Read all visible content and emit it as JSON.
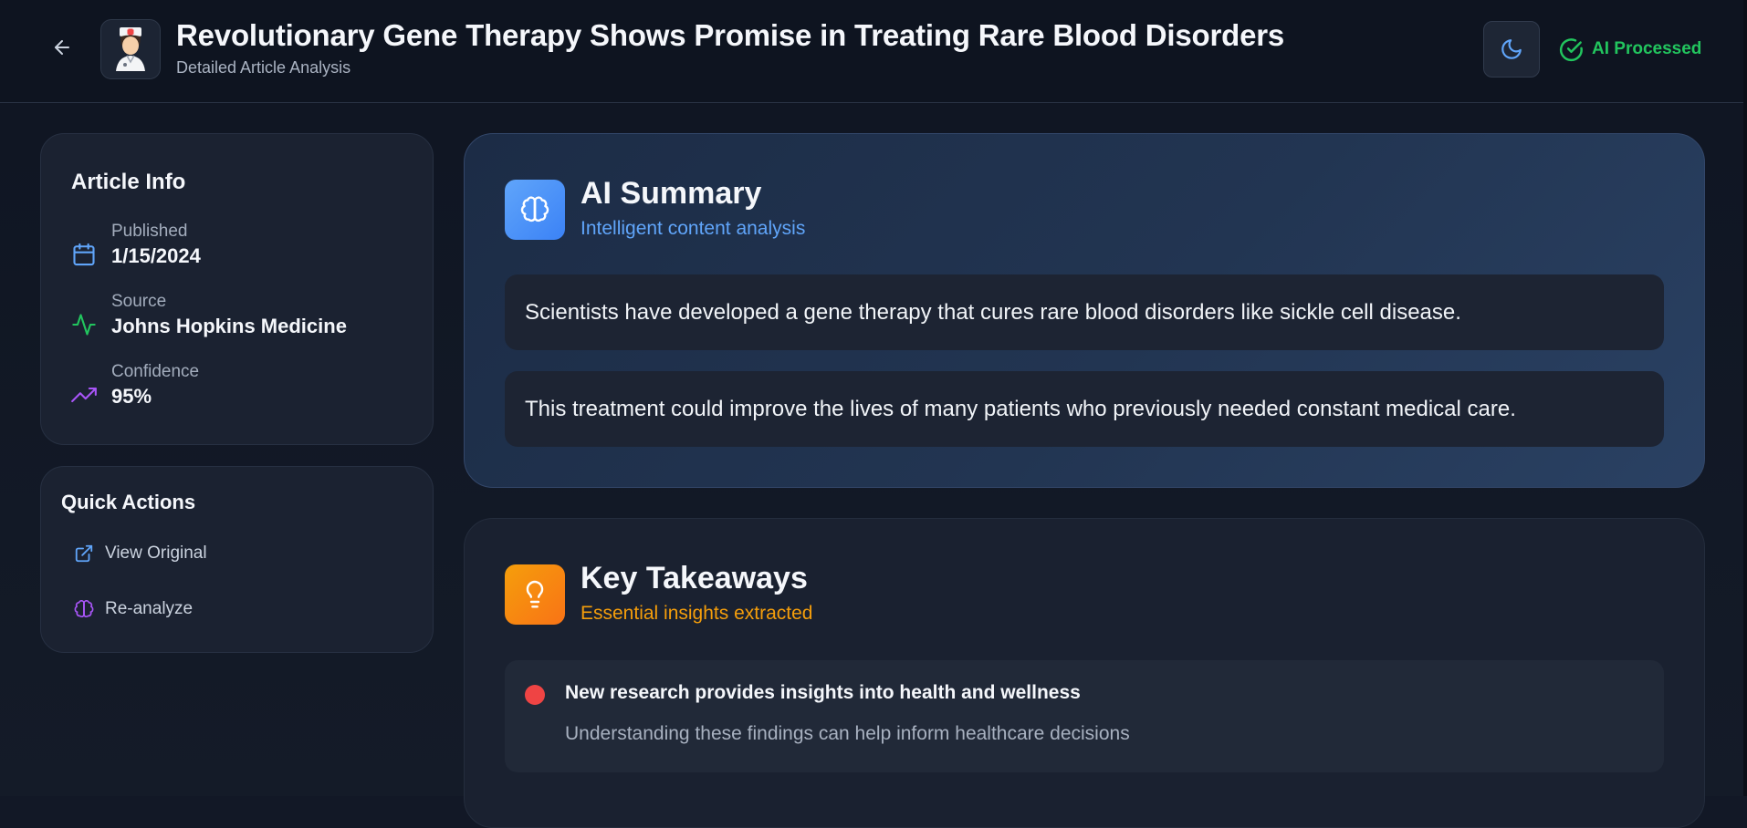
{
  "header": {
    "title": "Revolutionary Gene Therapy Shows Promise in Treating Rare Blood Disorders",
    "subtitle": "Detailed Article Analysis",
    "status": "AI Processed",
    "icons": {
      "back": "arrow-left-icon",
      "avatar": "doctor-avatar",
      "theme": "moon-icon",
      "status": "check-circle-icon"
    }
  },
  "article_info": {
    "title": "Article Info",
    "rows": [
      {
        "label": "Published",
        "value": "1/15/2024",
        "icon": "calendar-icon"
      },
      {
        "label": "Source",
        "value": "Johns Hopkins Medicine",
        "icon": "activity-icon"
      },
      {
        "label": "Confidence",
        "value": "95%",
        "icon": "trending-up-icon"
      }
    ]
  },
  "quick_actions": {
    "title": "Quick Actions",
    "items": [
      {
        "label": "View Original",
        "icon": "external-link-icon"
      },
      {
        "label": "Re-analyze",
        "icon": "brain-icon"
      }
    ]
  },
  "ai_summary": {
    "title": "AI Summary",
    "subtitle": "Intelligent content analysis",
    "icon": "brain-icon",
    "items": [
      "Scientists have developed a gene therapy that cures rare blood disorders like sickle cell disease.",
      "This treatment could improve the lives of many patients who previously needed constant medical care."
    ]
  },
  "key_takeaways": {
    "title": "Key Takeaways",
    "subtitle": "Essential insights extracted",
    "icon": "lightbulb-icon",
    "items": [
      {
        "title": "New research provides insights into health and wellness",
        "description": "Understanding these findings can help inform healthcare decisions"
      }
    ]
  },
  "colors": {
    "accent_blue": "#60a5fa",
    "success_green": "#22c55e",
    "purple": "#a855f7",
    "amber": "#f59e0b",
    "red_dot": "#ef4444"
  }
}
